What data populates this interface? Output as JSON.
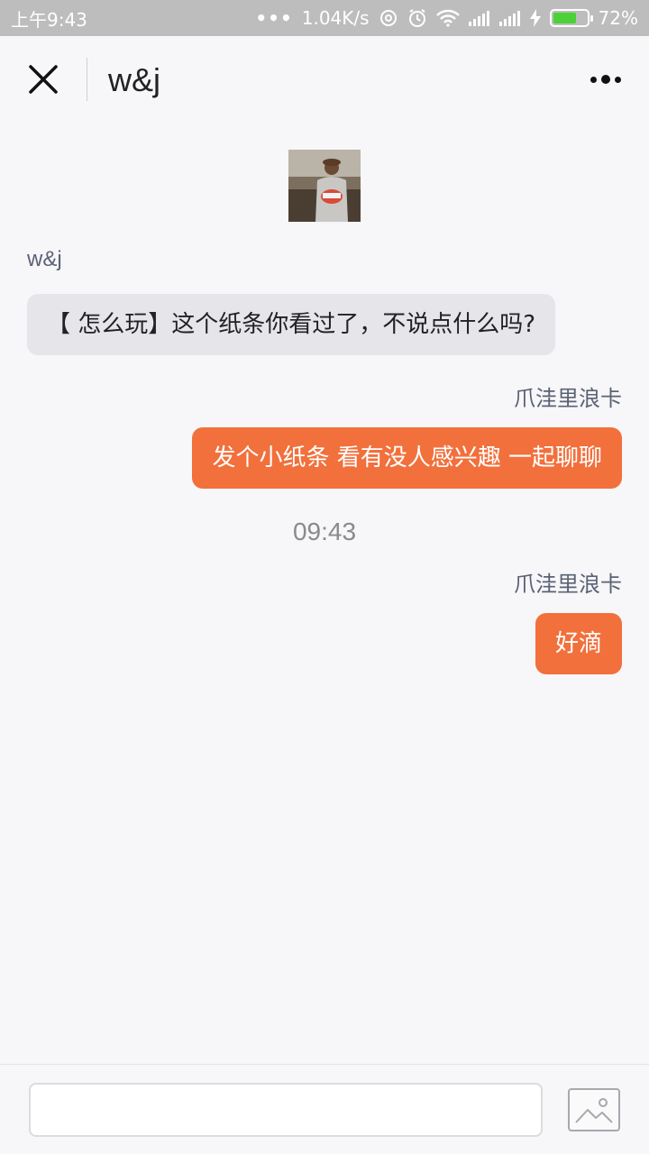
{
  "status_bar": {
    "time": "上午9:43",
    "network_speed": "1.04K/s",
    "battery_percent": "72%",
    "battery_level": 0.72,
    "icons": [
      "more-dots-icon",
      "hotspot-icon",
      "alarm-icon",
      "wifi-icon",
      "signal-icon",
      "signal-icon",
      "charging-icon",
      "battery-icon"
    ]
  },
  "header": {
    "title": "w&j",
    "close_icon": "close-icon",
    "more_icon": "more-icon"
  },
  "conversation": {
    "peer_name": "w&j",
    "messages": [
      {
        "direction": "in",
        "sender": "w&j",
        "text": "【 怎么玩】这个纸条你看过了，不说点什么吗?"
      },
      {
        "direction": "out",
        "sender": "爪洼里浪卡",
        "text": "发个小纸条 看有没人感兴趣 一起聊聊"
      },
      {
        "direction": "out",
        "sender": "爪洼里浪卡",
        "text": "好滴"
      }
    ],
    "timestamp": "09:43"
  },
  "input_bar": {
    "placeholder": "",
    "image_icon": "image-icon"
  },
  "colors": {
    "accent": "#f2703c",
    "incoming_bubble": "#e6e5ea",
    "background": "#f7f6f8",
    "status_bar": "#bdbdbd",
    "battery_fill": "#4cd137"
  }
}
